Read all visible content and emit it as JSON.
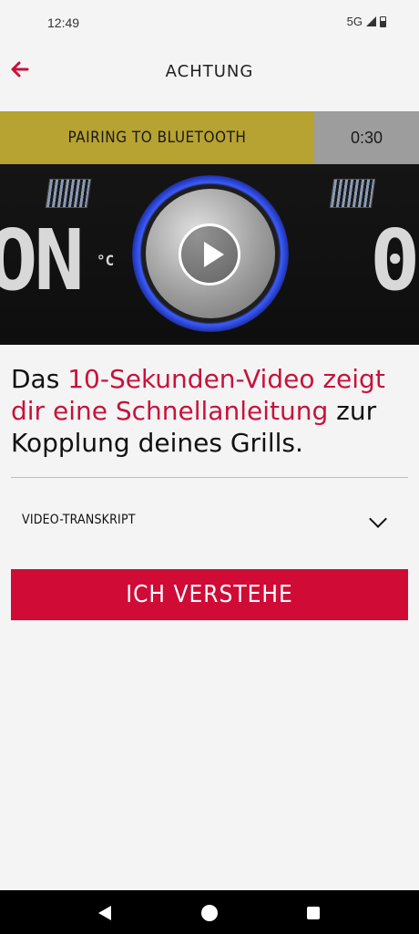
{
  "status": {
    "time": "12:49",
    "network": "5G"
  },
  "header": {
    "title": "ACHTUNG",
    "back_icon": "arrow-left-icon",
    "accent": "#c8123c"
  },
  "video": {
    "banner_title": "PAIRING TO BLUETOOTH",
    "duration": "0:30",
    "display_left": "ON",
    "unit": "°C",
    "display_right": "0",
    "play_icon": "play-icon"
  },
  "message": {
    "part1": "Das ",
    "highlight": "10-Sekunden-Video zeigt dir eine Schnellanleitung",
    "part2": " zur Kopplung deines Grills."
  },
  "transcript": {
    "label": "VIDEO-TRANSKRIPT"
  },
  "cta": {
    "label": "ICH VERSTEHE",
    "color": "#cf0b36"
  }
}
